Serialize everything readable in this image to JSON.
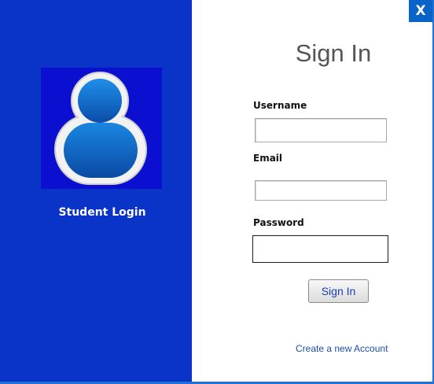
{
  "window": {
    "close_label": "X"
  },
  "sidebar": {
    "avatar_icon": "user-silhouette-icon",
    "caption": "Student Login"
  },
  "form": {
    "title": "Sign In",
    "username_label": "Username",
    "username_value": "",
    "email_label": "Email",
    "email_value": "",
    "password_label": "Password",
    "password_value": "",
    "submit_label": "Sign In",
    "create_account_label": "Create a new Account"
  },
  "colors": {
    "sidebar_bg": "#0a33c8",
    "avatar_bg": "#0a0fd0",
    "close_bg": "#0a63c6",
    "link": "#1a4fb3"
  }
}
